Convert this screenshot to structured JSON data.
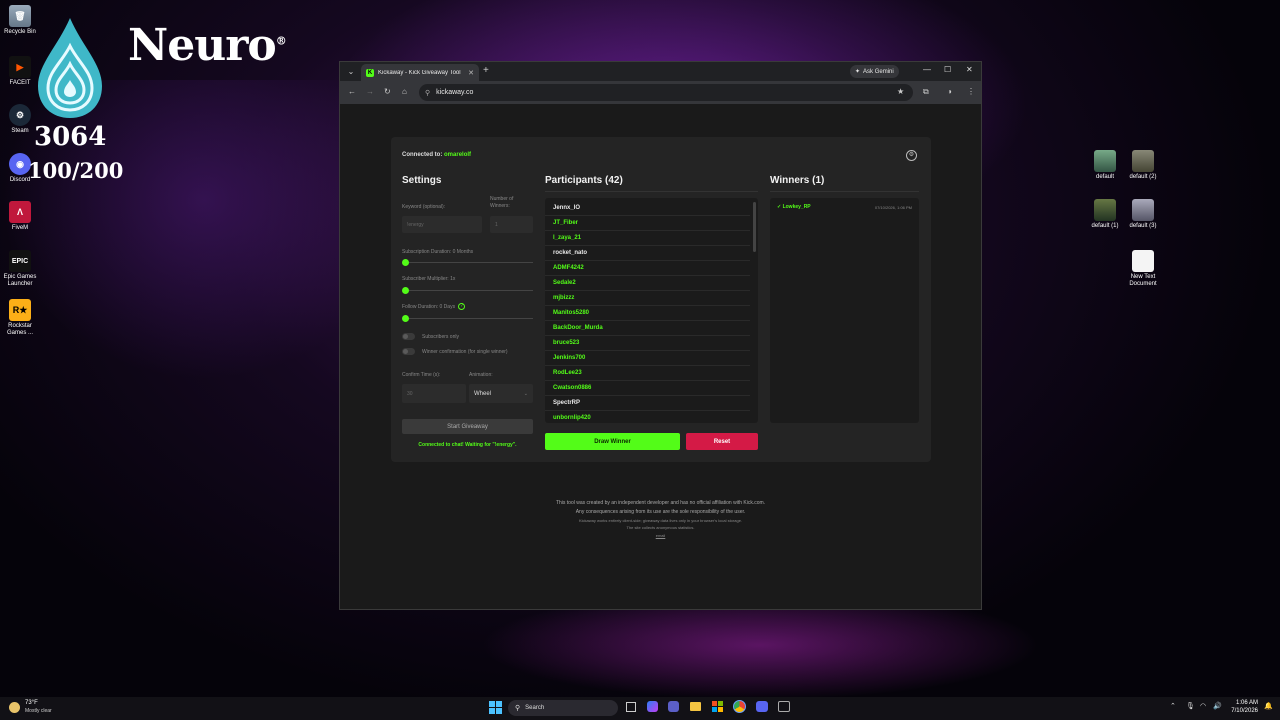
{
  "desktop": {
    "icons": [
      {
        "label": "Recycle Bin",
        "icon": "recycle-bin-icon"
      },
      {
        "label": "FACEIT",
        "icon": "faceit-icon"
      },
      {
        "label": "Steam",
        "icon": "steam-icon"
      },
      {
        "label": "Discord",
        "icon": "discord-icon"
      },
      {
        "label": "FiveM",
        "icon": "fivem-icon"
      },
      {
        "label": "Epic Games Launcher",
        "icon": "epic-games-icon"
      },
      {
        "label": "Rockstar Games ...",
        "icon": "rockstar-icon"
      }
    ],
    "right_icons": [
      {
        "label": "default"
      },
      {
        "label": "default (2)"
      },
      {
        "label": "default (1)"
      },
      {
        "label": "default (3)"
      },
      {
        "label": "New Text Document"
      }
    ]
  },
  "overlay": {
    "brand": "Neuro",
    "reg": "®",
    "score": "3064",
    "progress": "100/200"
  },
  "browser": {
    "tab_title": "Kickaway - Kick Giveaway Tool",
    "ask_gemini": "Ask Gemini",
    "url": "kickaway.co"
  },
  "app": {
    "connected_label": "Connected to:",
    "connected_user": "omarelolf",
    "settings": {
      "title": "Settings",
      "keyword_label": "Keyword (optional):",
      "keyword_value": "!energy",
      "winners_label": "Number of Winners:",
      "winners_value": "1",
      "sub_duration_label": "Subscription Duration: 0 Months",
      "sub_multiplier_label": "Subscriber Multiplier: 1x",
      "follow_duration_label": "Follow Duration:  0  Days",
      "subscribers_only_label": "Subscribers only",
      "winner_confirmation_label": "Winner confirmation (for single winner)",
      "confirm_time_label": "Confirm Time (s):",
      "confirm_time_value": "30",
      "animation_label": "Animation:",
      "animation_value": "Wheel",
      "start_button": "Start Giveaway",
      "status": "Connected to chat! Waiting for \"!energy\"."
    },
    "participants": {
      "title": "Participants (42)",
      "items": [
        {
          "name": "Jennx_IO",
          "color": "#e8e8e8"
        },
        {
          "name": "JT_Fiber",
          "color": "#53fc18"
        },
        {
          "name": "l_zaya_21",
          "color": "#53fc18"
        },
        {
          "name": "rocket_nato",
          "color": "#e8e8e8"
        },
        {
          "name": "ADMF4242",
          "color": "#53fc18"
        },
        {
          "name": "Sedale2",
          "color": "#53fc18"
        },
        {
          "name": "mjbizzz",
          "color": "#53fc18"
        },
        {
          "name": "Manitos5280",
          "color": "#53fc18"
        },
        {
          "name": "BackDoor_Murda",
          "color": "#53fc18"
        },
        {
          "name": "bruce523",
          "color": "#53fc18"
        },
        {
          "name": "Jenkins700",
          "color": "#53fc18"
        },
        {
          "name": "RodLee23",
          "color": "#53fc18"
        },
        {
          "name": "Cwatson0886",
          "color": "#53fc18"
        },
        {
          "name": "SpectrRP",
          "color": "#e8e8e8"
        },
        {
          "name": "unbornlip420",
          "color": "#53fc18"
        }
      ],
      "draw_button": "Draw Winner",
      "reset_button": "Reset"
    },
    "winners": {
      "title": "Winners (1)",
      "items": [
        {
          "name": "✓ Lowkey_RP",
          "time": "07/10/2026, 1:06 PM"
        }
      ]
    },
    "footer": {
      "line1": "This tool was created by an independent developer and has no official affiliation with Kick.com.",
      "line2": "Any consequences arising from its use are the sole responsibility of the user.",
      "line3": "Kickaway works entirely client-side; giveaway data lives only in your browser's local storage.",
      "line4": "The site collects anonymous statistics.",
      "link": "email"
    }
  },
  "taskbar": {
    "weather_temp": "73°F",
    "weather_desc": "Mostly clear",
    "search": "Search",
    "time": "1:06 AM",
    "date": "7/10/2026"
  }
}
